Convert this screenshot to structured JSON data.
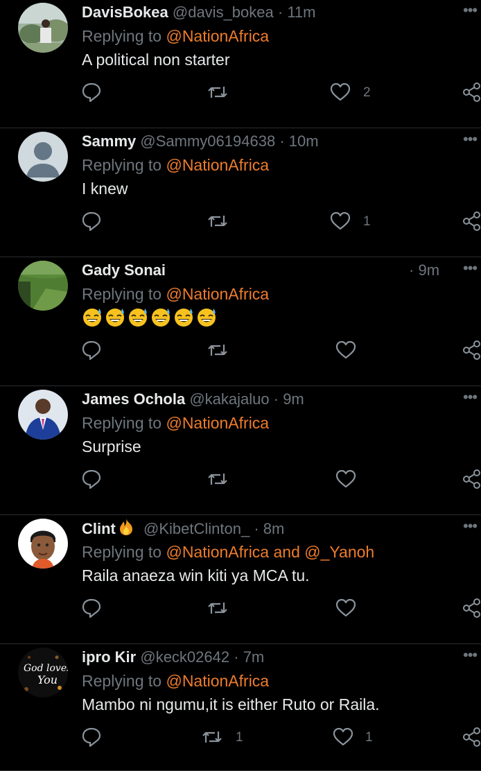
{
  "reply_prefix": "Replying to",
  "tweets": [
    {
      "name": "DavisBokea",
      "handle": "@davis_bokea",
      "sep": "·",
      "time": "11m",
      "reply_to": "@NationAfrica",
      "text": "A political non starter",
      "likes": "2",
      "retweets": ""
    },
    {
      "name": "Sammy",
      "handle": "@Sammy06194638",
      "sep": "·",
      "time": "10m",
      "reply_to": "@NationAfrica",
      "text": "I knew",
      "likes": "1",
      "retweets": ""
    },
    {
      "name": "Gady Sonai",
      "handle": "",
      "sep": "·",
      "time": "9m",
      "reply_to": "@NationAfrica",
      "text": "",
      "emoji_count": 6,
      "likes": "",
      "retweets": ""
    },
    {
      "name": "James Ochola",
      "handle": "@kakajaluo",
      "sep": "·",
      "time": "9m",
      "reply_to": "@NationAfrica",
      "text": "Surprise",
      "likes": "",
      "retweets": ""
    },
    {
      "name": "Clint",
      "handle": "@KibetClinton_",
      "sep": "·",
      "time": "8m",
      "reply_to": "@NationAfrica and @_Yanoh",
      "text": "Raila anaeza win kiti ya MCA tu.",
      "likes": "",
      "retweets": ""
    },
    {
      "name": "ipro Kir",
      "handle": "@keck02642",
      "sep": "·",
      "time": "7m",
      "reply_to": "@NationAfrica",
      "text": "Mambo ni ngumu,it is either Ruto or Raila.",
      "likes": "1",
      "retweets": "1"
    }
  ],
  "avatar_texts": {
    "god_loves_1": "God loves",
    "god_loves_2": "You"
  },
  "colors": {
    "background": "#000000",
    "text": "#e7e9ea",
    "muted": "#6e767d",
    "mention": "#ee7c2c",
    "divider": "#2a2d31"
  },
  "icons": [
    "reply-icon",
    "retweet-icon",
    "like-icon",
    "share-icon",
    "more-icon",
    "fire-emoji",
    "grinning-sweat-emoji"
  ]
}
